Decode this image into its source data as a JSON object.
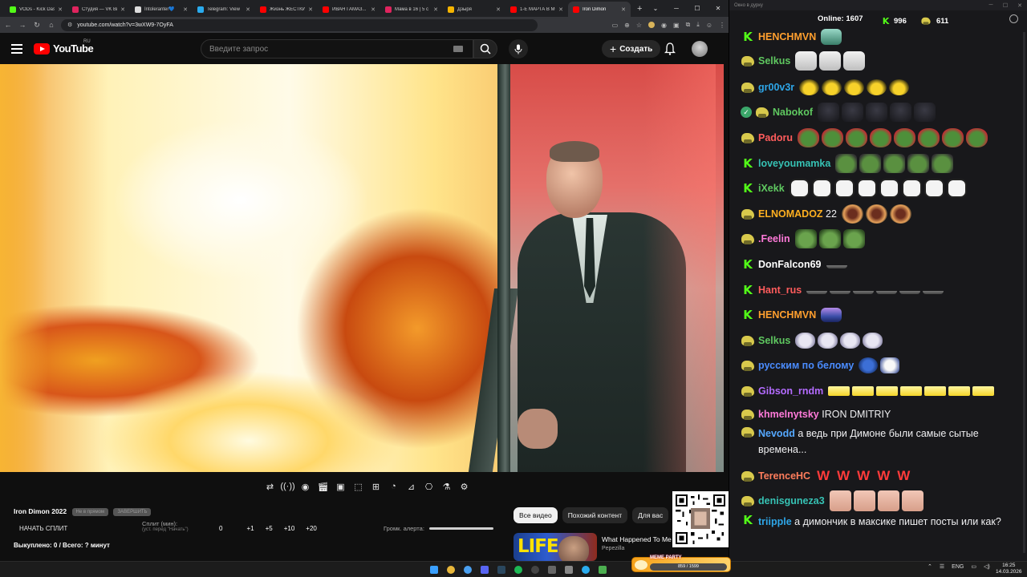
{
  "browser": {
    "tabs": [
      {
        "title": "VODs - Kick Dashbo",
        "color": "#53fc18"
      },
      {
        "title": "Студия — VK Видео",
        "color": "#e0245e"
      },
      {
        "title": "Intoleranter💙",
        "color": "#dddddd"
      },
      {
        "title": "Telegram: View",
        "color": "#2aabee"
      },
      {
        "title": "Жизнь ЖЁСТКИЙ",
        "color": "#ff0000"
      },
      {
        "title": "ИВАН ГАМАЗ...",
        "color": "#ff0000"
      },
      {
        "title": "Мама в 16 | 5 с",
        "color": "#e0245e"
      },
      {
        "title": "Дзыря",
        "color": "#f5b400"
      },
      {
        "title": "1-Е МАРТА В МОЕ",
        "color": "#ff0000"
      },
      {
        "title": "Iron Dimon",
        "color": "#ff0000",
        "active": true
      }
    ],
    "new_tab": "+",
    "url": "youtube.com/watch?v=3wXW9-7OyFA"
  },
  "youtube": {
    "logo_text": "YouTube",
    "logo_region": "RU",
    "search_placeholder": "Введите запрос",
    "create_label": "Создать"
  },
  "split_panel": {
    "title": "Iron Dimon 2022",
    "pill_1": "Не в прямом",
    "pill_2": "ЗАВЕРШИТЬ",
    "start_label": "НАЧАТЬ СПЛИТ",
    "split_label": "Сплит (мин):",
    "split_hint": "(уст. перед \"Начать\")",
    "values": [
      "0",
      "+1",
      "+5",
      "+10",
      "+20"
    ],
    "volume_label": "Громк. алерта:",
    "volume_level": 1.0,
    "bought": "Выкуплено: 0 / Всего: ? минут"
  },
  "suggestions": {
    "chips": [
      "Все видео",
      "Похожий контент",
      "Для вас"
    ],
    "rec_title": "What Happened To Me",
    "rec_channel": "Pepezilla",
    "rec_thumb_text": "LIFE"
  },
  "taskbar": {
    "meme_tag": "MEME PARTY",
    "meme_progress": "859 / 1599",
    "lang": "ENG",
    "time": "16:25",
    "date": "14.03.2026"
  },
  "chat": {
    "window_title": "Окно в дурку",
    "online_label": "Online:",
    "online_count": "1607",
    "kick_count": "996",
    "sub_count": "611",
    "messages": [
      {
        "user": "HENCHMVN",
        "color": "#ff9f2e",
        "badge": "k",
        "emotes": [
          "e-bus"
        ]
      },
      {
        "user": "Selkus",
        "color": "#5fc860",
        "badge": "sub",
        "emotes": [
          "e-anime",
          "e-anime",
          "e-anime"
        ]
      },
      {
        "user": "gr00v3r",
        "color": "#2ea6e8",
        "badge": "sub",
        "emotes": [
          "e-pepe",
          "e-pepe",
          "e-pepe",
          "e-pepe",
          "e-pepe"
        ]
      },
      {
        "user": "Nabokof",
        "color": "#5fc860",
        "badge": "ver",
        "emotes": [
          "e-dark",
          "e-dark",
          "e-dark",
          "e-dark",
          "e-dark"
        ]
      },
      {
        "user": "Padoru",
        "color": "#ff5c5c",
        "badge": "sub",
        "emotes": [
          "e-frog",
          "e-frog",
          "e-frog",
          "e-frog",
          "e-frog",
          "e-frog",
          "e-frog",
          "e-frog"
        ]
      },
      {
        "user": "loveyoumamka",
        "color": "#36c2b4",
        "badge": "k",
        "emotes": [
          "e-frog2",
          "e-frog2",
          "e-frog2",
          "e-frog2",
          "e-frog2"
        ]
      },
      {
        "user": "iXekk",
        "color": "#5fc860",
        "badge": "k",
        "emotes": [
          "e-tooth",
          "e-tooth",
          "e-tooth",
          "e-tooth",
          "e-tooth",
          "e-tooth",
          "e-tooth",
          "e-tooth"
        ]
      },
      {
        "user": "ELNOMADOZ",
        "color": "#ffb020",
        "badge": "sub",
        "text": "22",
        "emotes": [
          "e-mouth",
          "e-mouth",
          "e-mouth"
        ]
      },
      {
        "user": ".Feelin",
        "color": "#ff7ad9",
        "badge": "sub",
        "emotes": [
          "e-frog3",
          "e-frog3",
          "e-frog3"
        ]
      },
      {
        "user": "DonFalcon69",
        "color": "#ffffff",
        "badge": "k",
        "emotes": [
          "e-hat"
        ]
      },
      {
        "user": "Hant_rus",
        "color": "#ff5c5c",
        "badge": "k",
        "emotes": [
          "e-hat",
          "e-hat",
          "e-hat",
          "e-hat",
          "e-hat",
          "e-hat"
        ]
      },
      {
        "user": "HENCHMVN",
        "color": "#ff9f2e",
        "badge": "k",
        "emotes": [
          "e-bus2"
        ]
      },
      {
        "user": "Selkus",
        "color": "#5fc860",
        "badge": "sub",
        "emotes": [
          "e-cat",
          "e-cat",
          "e-cat",
          "e-cat"
        ]
      },
      {
        "user": "русским по белому",
        "color": "#4a8cff",
        "badge": "sub",
        "emotes": [
          "e-blue",
          "e-bird"
        ]
      },
      {
        "user": "Gibson_rndm",
        "color": "#b36bff",
        "badge": "sub",
        "emotes": [
          "e-bar",
          "e-bar",
          "e-bar",
          "e-bar",
          "e-bar",
          "e-bar",
          "e-bar"
        ]
      },
      {
        "user": "khmelnytsky",
        "color": "#ff7ad9",
        "badge": "sub",
        "text": "IRON DMITRIY"
      },
      {
        "user": "Nevodd",
        "color": "#55a8ff",
        "badge": "sub",
        "text": "а ведь при Димоне были самые сытые времена..."
      },
      {
        "user": "TerenceHC",
        "color": "#ff7d5c",
        "badge": "sub",
        "wwords": [
          "W",
          "W",
          "W",
          "W",
          "W"
        ]
      },
      {
        "user": "denisguneza3",
        "color": "#36c2b4",
        "badge": "sub",
        "emotes": [
          "e-hand",
          "e-hand",
          "e-hand",
          "e-hand"
        ]
      },
      {
        "user": "triipple",
        "color": "#2ea6e8",
        "badge": "k",
        "text": "а димончик в максике пишет посты или как?"
      }
    ]
  }
}
